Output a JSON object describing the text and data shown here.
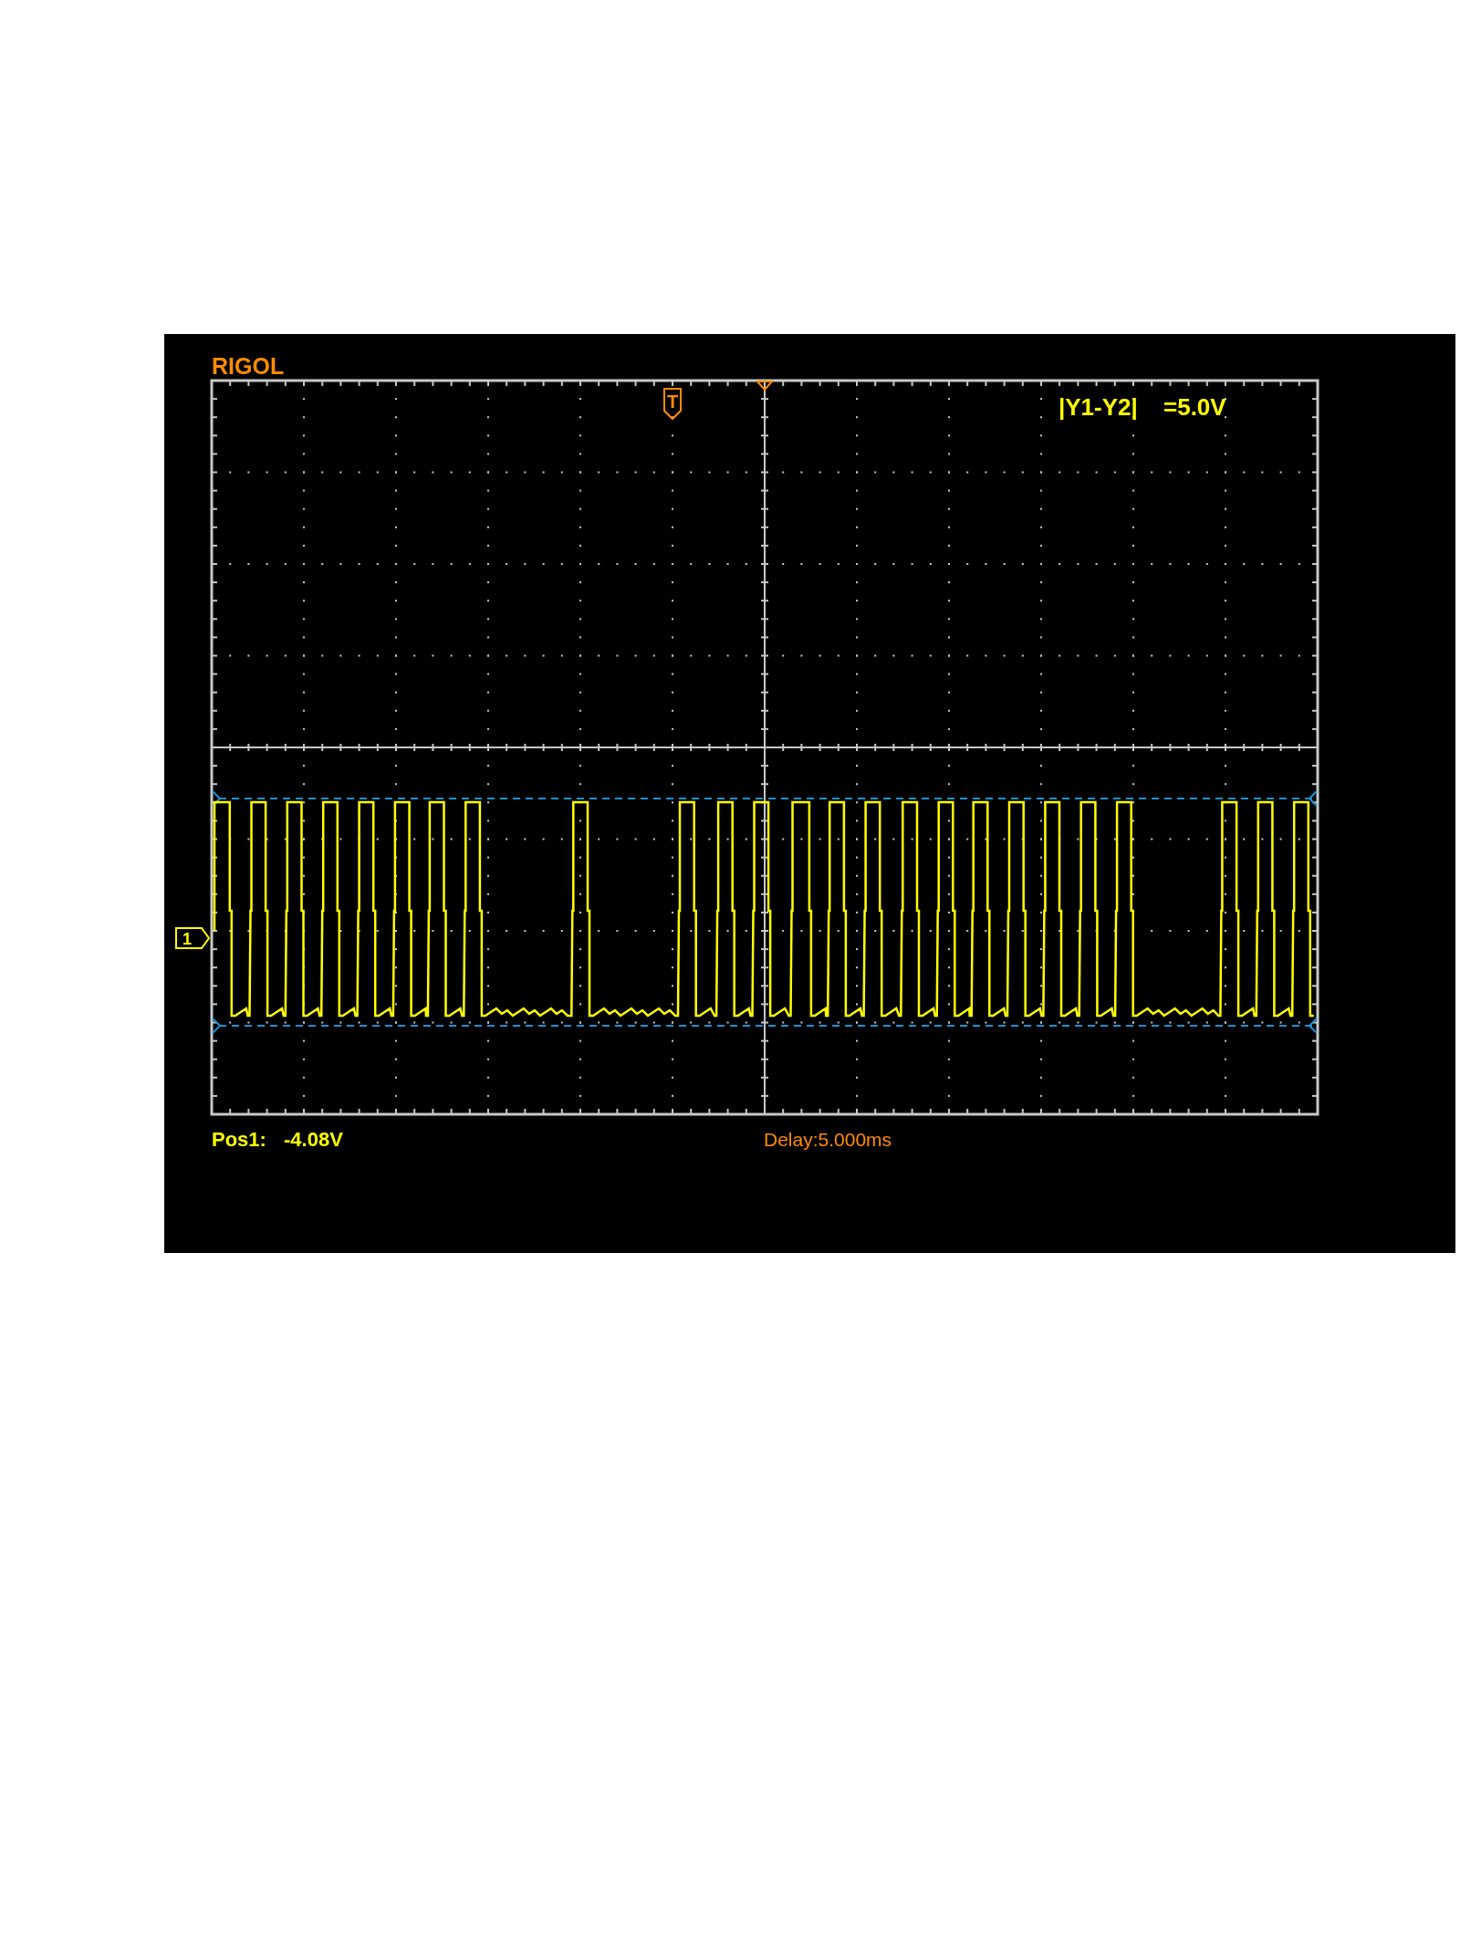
{
  "scope": {
    "brand": "RIGOL",
    "trigger_marker": "T",
    "channel_marker": "1",
    "cursor_readout": {
      "label": "|Y1-Y2|",
      "value": "=5.0V"
    },
    "position": {
      "label": "Pos1:",
      "value": "-4.08V"
    },
    "delay": "Delay:5.000ms"
  }
}
